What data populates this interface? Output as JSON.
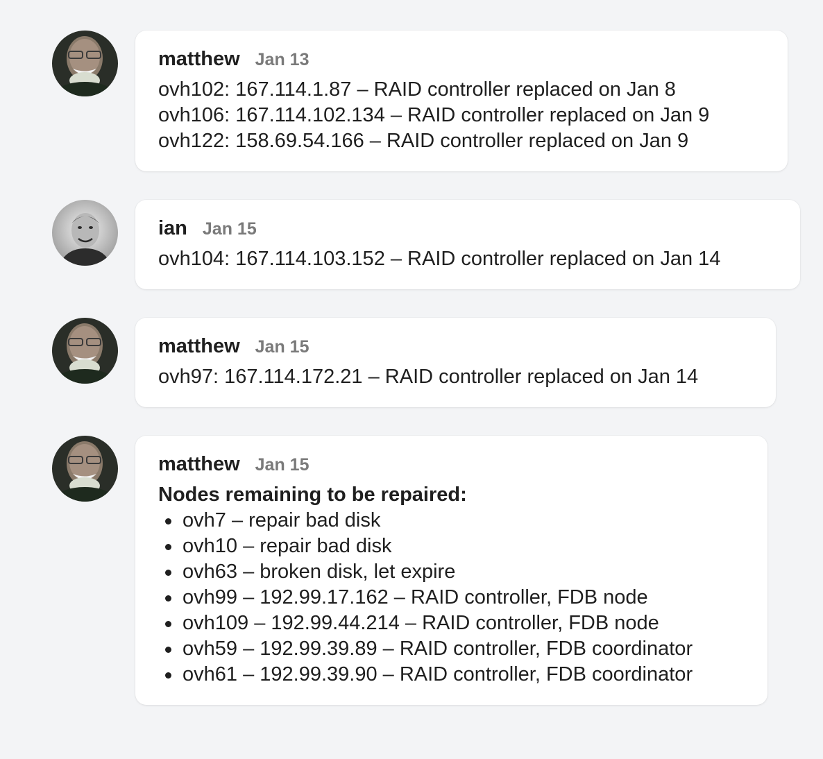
{
  "messages": [
    {
      "author": "matthew",
      "avatar": "matthew-avatar",
      "time": "Jan 13",
      "lines": [
        "ovh102: 167.114.1.87 – RAID controller replaced on Jan 8",
        "ovh106: 167.114.102.134 – RAID controller replaced on Jan 9",
        "ovh122: 158.69.54.166 – RAID controller replaced on Jan 9"
      ]
    },
    {
      "author": "ian",
      "avatar": "ian-avatar",
      "time": "Jan 15",
      "lines": [
        "ovh104: 167.114.103.152 – RAID controller replaced on Jan 14"
      ]
    },
    {
      "author": "matthew",
      "avatar": "matthew-avatar",
      "time": "Jan 15",
      "lines": [
        "ovh97: 167.114.172.21 – RAID controller replaced on Jan 14"
      ]
    },
    {
      "author": "matthew",
      "avatar": "matthew-avatar",
      "time": "Jan 15",
      "heading": "Nodes remaining to be repaired:",
      "items": [
        "ovh7 – repair bad disk",
        "ovh10 – repair bad disk",
        "ovh63 – broken disk, let expire",
        "ovh99 – 192.99.17.162 – RAID controller, FDB node",
        "ovh109 – 192.99.44.214 – RAID controller, FDB node",
        "ovh59 – 192.99.39.89 – RAID controller, FDB coordinator",
        "ovh61 – 192.99.39.90 – RAID controller, FDB coordinator"
      ]
    }
  ],
  "colors": {
    "background": "#f3f4f6",
    "bubble": "#ffffff",
    "author": "#1f1f1f",
    "timestamp": "#7a7a7a"
  }
}
